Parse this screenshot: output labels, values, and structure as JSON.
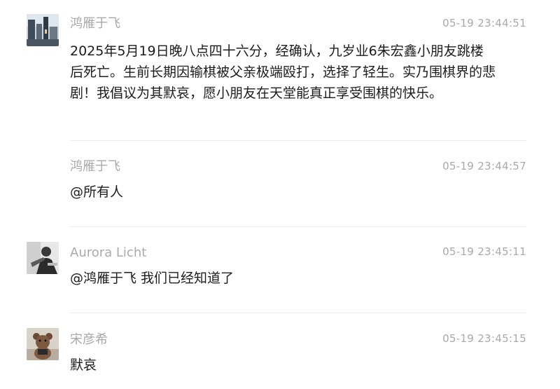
{
  "messages": [
    {
      "sender": "鸿雁于飞",
      "time": "05-19 23:44:51",
      "text": "2025年5月19日晚八点四十六分，经确认，九岁业6朱宏鑫小朋友跳楼后死亡。生前长期因输棋被父亲极端殴打，选择了轻生。实乃围棋界的悲剧！我倡议为其默哀，愿小朋友在天堂能真正享受围棋的快乐。",
      "avatar": "landscape-avatar"
    },
    {
      "sender": "鸿雁于飞",
      "time": "05-19 23:44:57",
      "text": "@所有人"
    },
    {
      "sender": "Aurora Licht",
      "time": "05-19 23:45:11",
      "text": "@鸿雁于飞 我们已经知道了",
      "avatar": "bw-photo-avatar"
    },
    {
      "sender": "宋彦希",
      "time": "05-19 23:45:15",
      "text": "默哀",
      "avatar": "teddy-bear-avatar"
    }
  ],
  "colors": {
    "meta_gray": "#a9a9a9",
    "text_dark": "#1c1c1c",
    "divider": "#ebebeb"
  }
}
